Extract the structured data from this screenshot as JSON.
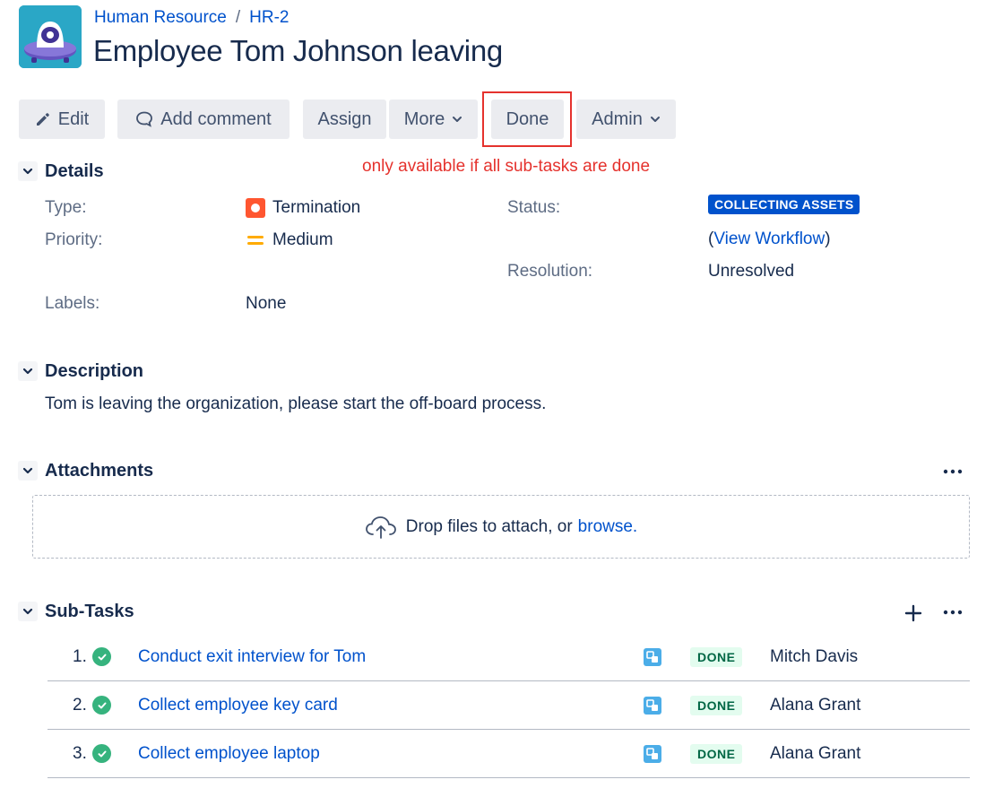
{
  "breadcrumb": {
    "project": "Human Resource",
    "separator": "/",
    "issue_key": "HR-2"
  },
  "issue": {
    "title": "Employee Tom Johnson leaving"
  },
  "toolbar": {
    "edit": "Edit",
    "add_comment": "Add comment",
    "assign": "Assign",
    "more": "More",
    "done": "Done",
    "admin": "Admin"
  },
  "annotation": {
    "text": "only available if all sub-tasks are done",
    "color": "#e5322d"
  },
  "details": {
    "title": "Details",
    "type_label": "Type:",
    "type_value": "Termination",
    "priority_label": "Priority:",
    "priority_value": "Medium",
    "labels_label": "Labels:",
    "labels_value": "None",
    "status_label": "Status:",
    "status_value": "COLLECTING ASSETS",
    "view_workflow_open": "(",
    "view_workflow": "View Workflow",
    "view_workflow_close": ")",
    "resolution_label": "Resolution:",
    "resolution_value": "Unresolved"
  },
  "description": {
    "title": "Description",
    "text": "Tom is leaving the organization, please start the off-board process."
  },
  "attachments": {
    "title": "Attachments",
    "drop_text": "Drop files to attach, or",
    "browse": "browse."
  },
  "subtasks": {
    "title": "Sub-Tasks",
    "items": [
      {
        "num": "1.",
        "summary": "Conduct exit interview for Tom",
        "status": "DONE",
        "assignee": "Mitch Davis"
      },
      {
        "num": "2.",
        "summary": "Collect employee key card",
        "status": "DONE",
        "assignee": "Alana Grant"
      },
      {
        "num": "3.",
        "summary": "Collect employee laptop",
        "status": "DONE",
        "assignee": "Alana Grant"
      }
    ]
  },
  "colors": {
    "link": "#0052cc",
    "status_lozenge": "#0052cc",
    "done_lozenge_bg": "#e3fcef",
    "done_lozenge_text": "#006644",
    "success_check": "#36b37e",
    "termination_icon": "#ff5630",
    "priority_medium": "#ffab00"
  }
}
